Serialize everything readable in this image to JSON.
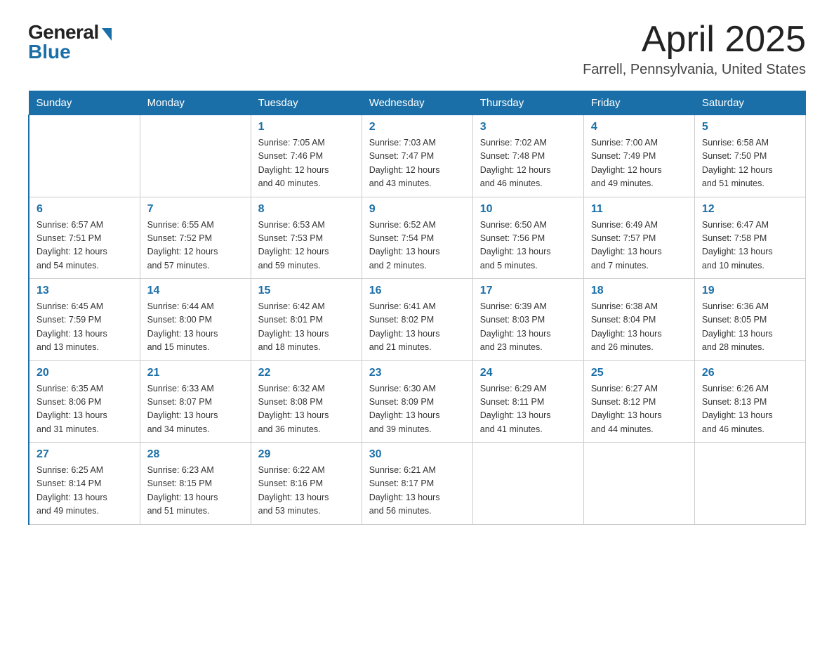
{
  "header": {
    "logo_general": "General",
    "logo_blue": "Blue",
    "month_title": "April 2025",
    "location": "Farrell, Pennsylvania, United States"
  },
  "days_of_week": [
    "Sunday",
    "Monday",
    "Tuesday",
    "Wednesday",
    "Thursday",
    "Friday",
    "Saturday"
  ],
  "weeks": [
    [
      {
        "day": "",
        "info": ""
      },
      {
        "day": "",
        "info": ""
      },
      {
        "day": "1",
        "info": "Sunrise: 7:05 AM\nSunset: 7:46 PM\nDaylight: 12 hours\nand 40 minutes."
      },
      {
        "day": "2",
        "info": "Sunrise: 7:03 AM\nSunset: 7:47 PM\nDaylight: 12 hours\nand 43 minutes."
      },
      {
        "day": "3",
        "info": "Sunrise: 7:02 AM\nSunset: 7:48 PM\nDaylight: 12 hours\nand 46 minutes."
      },
      {
        "day": "4",
        "info": "Sunrise: 7:00 AM\nSunset: 7:49 PM\nDaylight: 12 hours\nand 49 minutes."
      },
      {
        "day": "5",
        "info": "Sunrise: 6:58 AM\nSunset: 7:50 PM\nDaylight: 12 hours\nand 51 minutes."
      }
    ],
    [
      {
        "day": "6",
        "info": "Sunrise: 6:57 AM\nSunset: 7:51 PM\nDaylight: 12 hours\nand 54 minutes."
      },
      {
        "day": "7",
        "info": "Sunrise: 6:55 AM\nSunset: 7:52 PM\nDaylight: 12 hours\nand 57 minutes."
      },
      {
        "day": "8",
        "info": "Sunrise: 6:53 AM\nSunset: 7:53 PM\nDaylight: 12 hours\nand 59 minutes."
      },
      {
        "day": "9",
        "info": "Sunrise: 6:52 AM\nSunset: 7:54 PM\nDaylight: 13 hours\nand 2 minutes."
      },
      {
        "day": "10",
        "info": "Sunrise: 6:50 AM\nSunset: 7:56 PM\nDaylight: 13 hours\nand 5 minutes."
      },
      {
        "day": "11",
        "info": "Sunrise: 6:49 AM\nSunset: 7:57 PM\nDaylight: 13 hours\nand 7 minutes."
      },
      {
        "day": "12",
        "info": "Sunrise: 6:47 AM\nSunset: 7:58 PM\nDaylight: 13 hours\nand 10 minutes."
      }
    ],
    [
      {
        "day": "13",
        "info": "Sunrise: 6:45 AM\nSunset: 7:59 PM\nDaylight: 13 hours\nand 13 minutes."
      },
      {
        "day": "14",
        "info": "Sunrise: 6:44 AM\nSunset: 8:00 PM\nDaylight: 13 hours\nand 15 minutes."
      },
      {
        "day": "15",
        "info": "Sunrise: 6:42 AM\nSunset: 8:01 PM\nDaylight: 13 hours\nand 18 minutes."
      },
      {
        "day": "16",
        "info": "Sunrise: 6:41 AM\nSunset: 8:02 PM\nDaylight: 13 hours\nand 21 minutes."
      },
      {
        "day": "17",
        "info": "Sunrise: 6:39 AM\nSunset: 8:03 PM\nDaylight: 13 hours\nand 23 minutes."
      },
      {
        "day": "18",
        "info": "Sunrise: 6:38 AM\nSunset: 8:04 PM\nDaylight: 13 hours\nand 26 minutes."
      },
      {
        "day": "19",
        "info": "Sunrise: 6:36 AM\nSunset: 8:05 PM\nDaylight: 13 hours\nand 28 minutes."
      }
    ],
    [
      {
        "day": "20",
        "info": "Sunrise: 6:35 AM\nSunset: 8:06 PM\nDaylight: 13 hours\nand 31 minutes."
      },
      {
        "day": "21",
        "info": "Sunrise: 6:33 AM\nSunset: 8:07 PM\nDaylight: 13 hours\nand 34 minutes."
      },
      {
        "day": "22",
        "info": "Sunrise: 6:32 AM\nSunset: 8:08 PM\nDaylight: 13 hours\nand 36 minutes."
      },
      {
        "day": "23",
        "info": "Sunrise: 6:30 AM\nSunset: 8:09 PM\nDaylight: 13 hours\nand 39 minutes."
      },
      {
        "day": "24",
        "info": "Sunrise: 6:29 AM\nSunset: 8:11 PM\nDaylight: 13 hours\nand 41 minutes."
      },
      {
        "day": "25",
        "info": "Sunrise: 6:27 AM\nSunset: 8:12 PM\nDaylight: 13 hours\nand 44 minutes."
      },
      {
        "day": "26",
        "info": "Sunrise: 6:26 AM\nSunset: 8:13 PM\nDaylight: 13 hours\nand 46 minutes."
      }
    ],
    [
      {
        "day": "27",
        "info": "Sunrise: 6:25 AM\nSunset: 8:14 PM\nDaylight: 13 hours\nand 49 minutes."
      },
      {
        "day": "28",
        "info": "Sunrise: 6:23 AM\nSunset: 8:15 PM\nDaylight: 13 hours\nand 51 minutes."
      },
      {
        "day": "29",
        "info": "Sunrise: 6:22 AM\nSunset: 8:16 PM\nDaylight: 13 hours\nand 53 minutes."
      },
      {
        "day": "30",
        "info": "Sunrise: 6:21 AM\nSunset: 8:17 PM\nDaylight: 13 hours\nand 56 minutes."
      },
      {
        "day": "",
        "info": ""
      },
      {
        "day": "",
        "info": ""
      },
      {
        "day": "",
        "info": ""
      }
    ]
  ]
}
